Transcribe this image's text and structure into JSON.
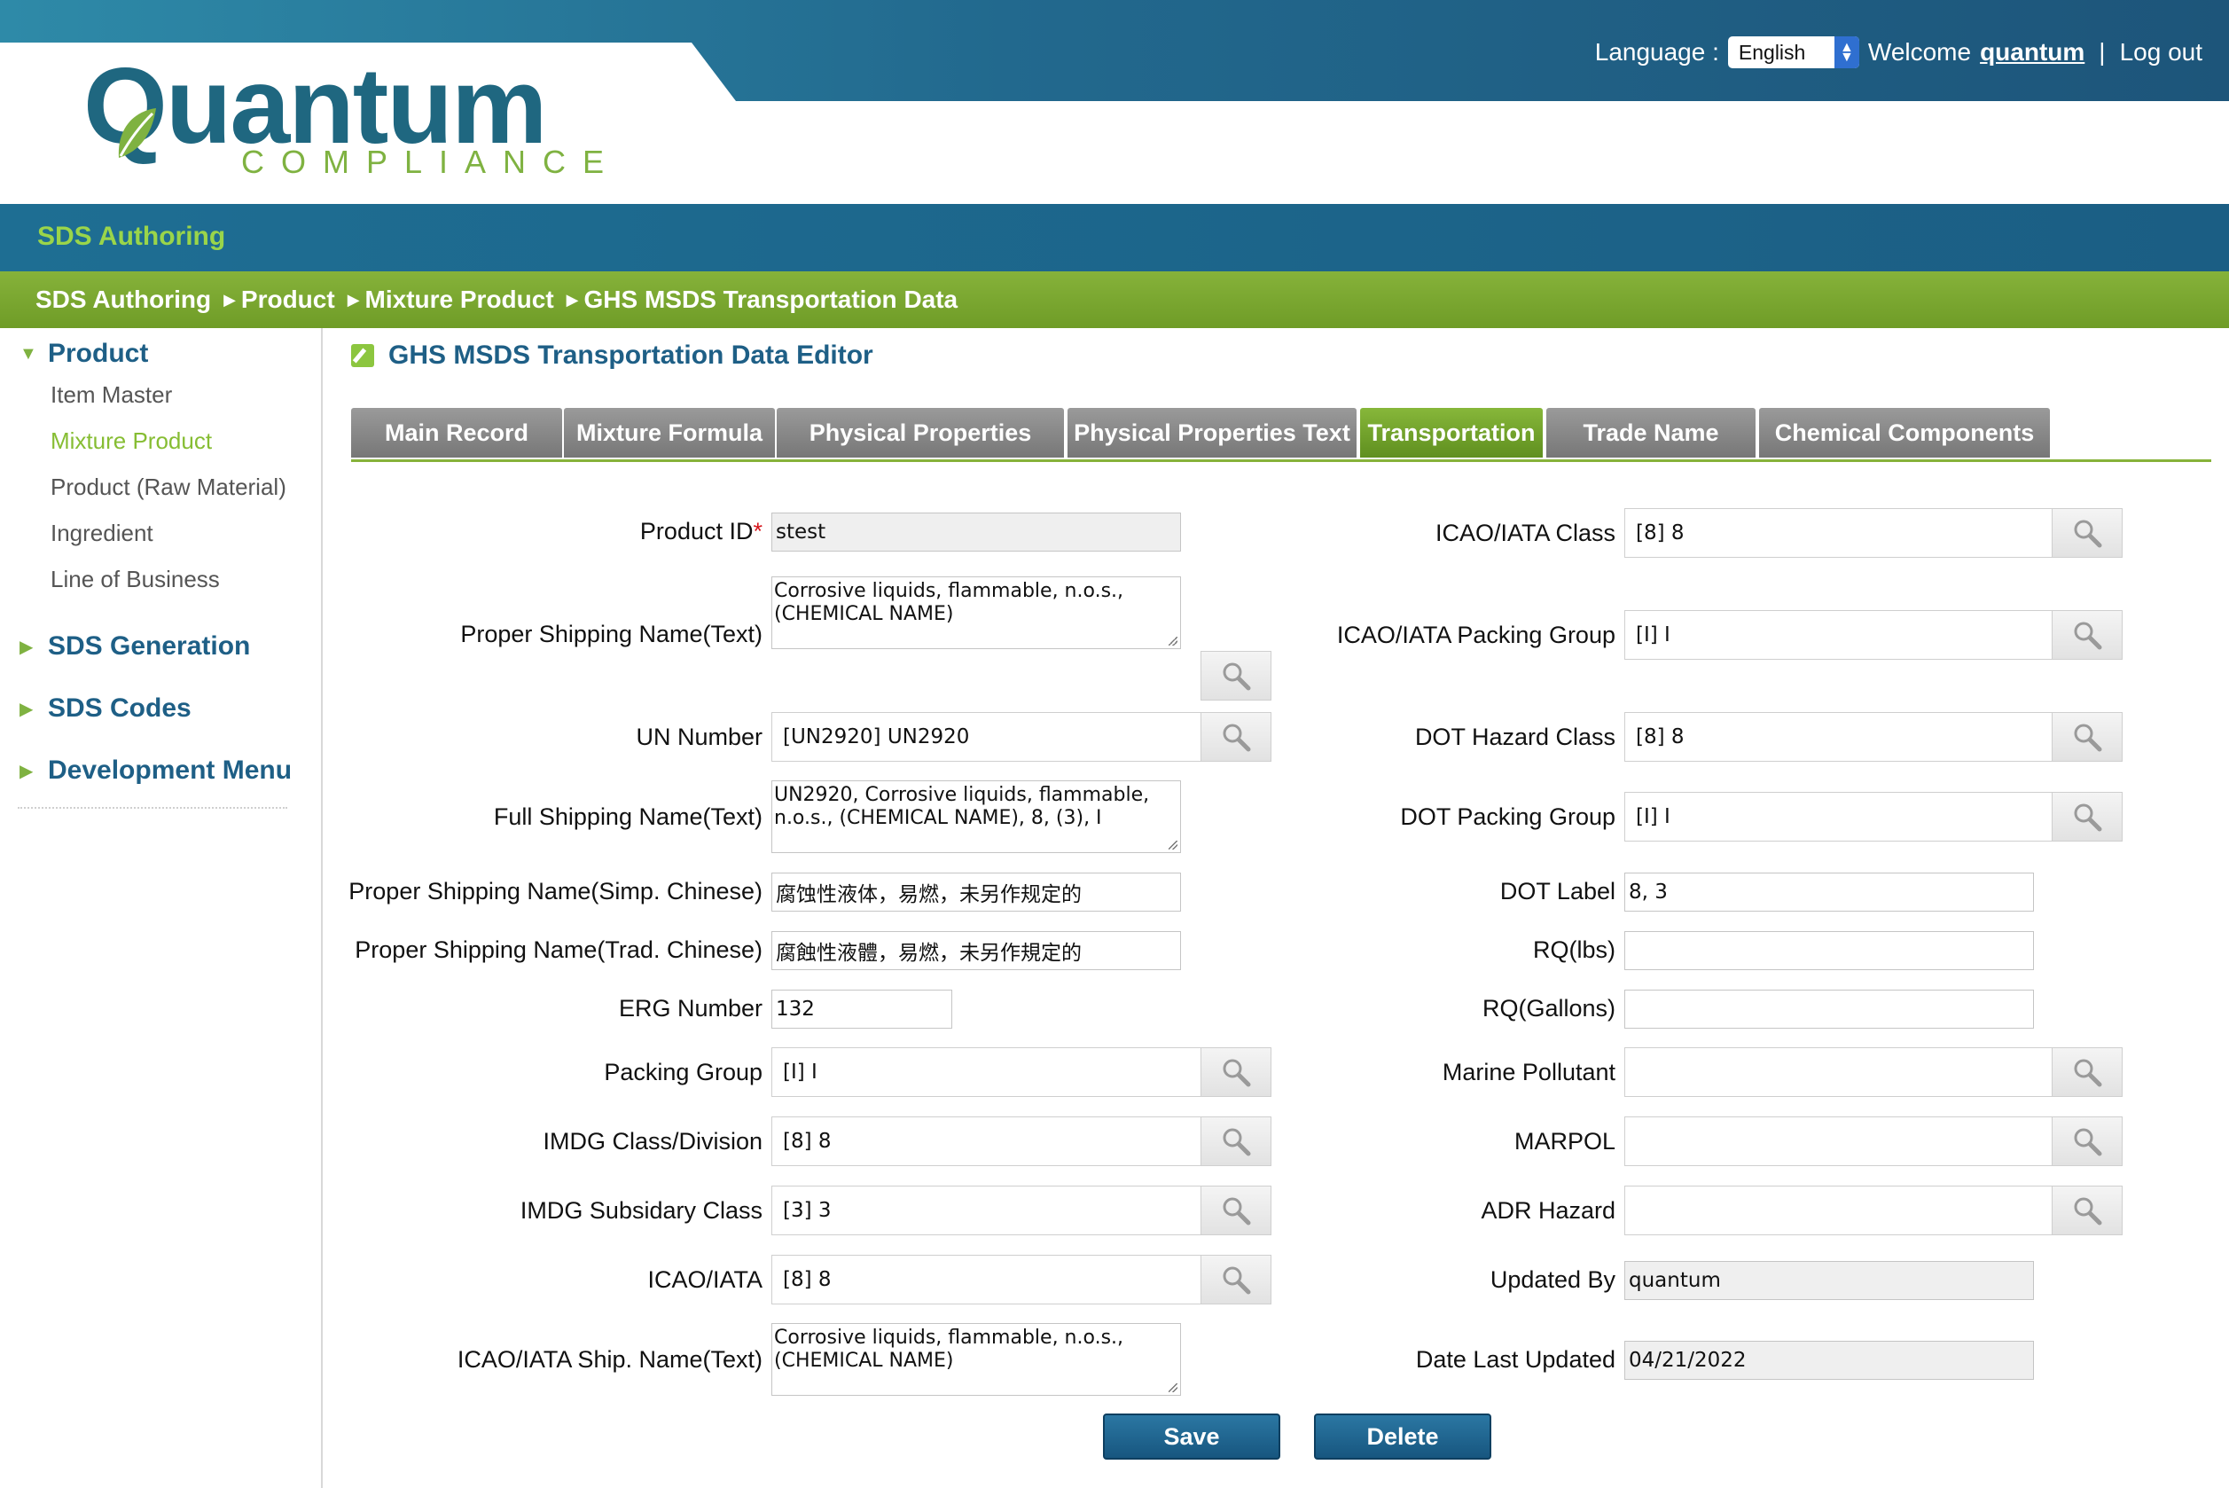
{
  "header": {
    "logo_word": "Quantum",
    "logo_sub": "COMPLIANCE",
    "language_label": "Language :",
    "language_value": "English",
    "welcome": "Welcome",
    "user": "quantum",
    "separator": "|",
    "logout": "Log out"
  },
  "app_title": "SDS Authoring",
  "breadcrumb": [
    "SDS Authoring",
    "Product",
    "Mixture Product",
    "GHS MSDS Transportation Data"
  ],
  "sidebar": {
    "product": "Product",
    "items": [
      "Item Master",
      "Mixture Product",
      "Product (Raw Material)",
      "Ingredient",
      "Line of Business"
    ],
    "sds_generation": "SDS Generation",
    "sds_codes": "SDS Codes",
    "development_menu": "Development Menu"
  },
  "editor_title": "GHS MSDS Transportation Data Editor",
  "tabs": [
    "Main Record",
    "Mixture Formula",
    "Physical Properties",
    "Physical Properties Text",
    "Transportation",
    "Trade Name",
    "Chemical Components"
  ],
  "left": {
    "product_id": {
      "label": "Product ID",
      "req": "*",
      "value": "stest"
    },
    "proper_shipping_name": {
      "label": "Proper Shipping Name(Text)",
      "value": "Corrosive liquids, flammable, n.o.s., (CHEMICAL NAME)"
    },
    "un_number": {
      "label": "UN Number",
      "value": "[UN2920] UN2920"
    },
    "full_shipping_name": {
      "label": "Full Shipping Name(Text)",
      "value": "UN2920, Corrosive liquids, flammable, n.o.s., (CHEMICAL NAME), 8, (3), I"
    },
    "psn_simp_chinese": {
      "label": "Proper Shipping Name(Simp. Chinese)",
      "value": "腐蚀性液体，易燃，未另作规定的"
    },
    "psn_trad_chinese": {
      "label": "Proper Shipping Name(Trad. Chinese)",
      "value": "腐蝕性液體，易燃，未另作規定的"
    },
    "erg_number": {
      "label": "ERG Number",
      "value": "132"
    },
    "packing_group": {
      "label": "Packing Group",
      "value": "[I] I"
    },
    "imdg_class": {
      "label": "IMDG Class/Division",
      "value": "[8] 8"
    },
    "imdg_subsidiary": {
      "label": "IMDG Subsidary Class",
      "value": "[3] 3"
    },
    "icao_iata": {
      "label": "ICAO/IATA",
      "value": "[8] 8"
    },
    "icao_ship_name": {
      "label": "ICAO/IATA Ship. Name(Text)",
      "value": "Corrosive liquids, flammable, n.o.s., (CHEMICAL NAME)"
    }
  },
  "right": {
    "icao_class": {
      "label": "ICAO/IATA Class",
      "value": "[8] 8"
    },
    "icao_packing_group": {
      "label": "ICAO/IATA Packing Group",
      "value": "[I] I"
    },
    "dot_hazard_class": {
      "label": "DOT Hazard Class",
      "value": "[8] 8"
    },
    "dot_packing_group": {
      "label": "DOT Packing Group",
      "value": "[I] I"
    },
    "dot_label": {
      "label": "DOT Label",
      "value": "8, 3"
    },
    "rq_lbs": {
      "label": "RQ(lbs)",
      "value": ""
    },
    "rq_gallons": {
      "label": "RQ(Gallons)",
      "value": ""
    },
    "marine_pollutant": {
      "label": "Marine Pollutant",
      "value": ""
    },
    "marpol": {
      "label": "MARPOL",
      "value": ""
    },
    "adr_hazard": {
      "label": "ADR Hazard",
      "value": ""
    },
    "updated_by": {
      "label": "Updated By",
      "value": "quantum"
    },
    "date_last_updated": {
      "label": "Date Last Updated",
      "value": "04/21/2022"
    }
  },
  "buttons": {
    "save": "Save",
    "delete": "Delete"
  },
  "colors": {
    "brand_blue": "#1e5f86",
    "brand_green": "#7fb241",
    "tab_active": "#6f9c27"
  }
}
